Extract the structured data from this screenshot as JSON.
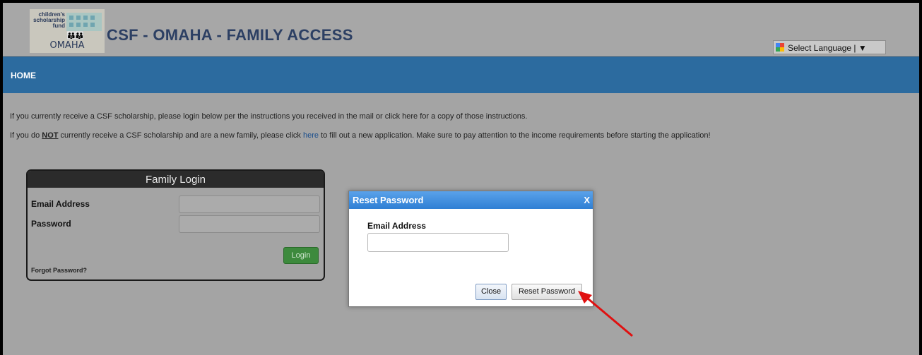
{
  "header": {
    "logo": {
      "line1": "children's",
      "line2": "scholarship",
      "line3": "fund",
      "city": "OMAHA"
    },
    "title": "CSF - OMAHA - FAMILY ACCESS",
    "language_select": {
      "label": "Select Language",
      "arrow": "▼"
    }
  },
  "nav": {
    "home": "HOME"
  },
  "content": {
    "line1": "If you currently receive a CSF scholarship, please login below per the instructions you received in the mail or click here for a copy of those instructions.",
    "line2_a": "If you do ",
    "line2_not": "NOT",
    "line2_b": " currently receive a CSF scholarship and are a new family, please click ",
    "line2_link": "here",
    "line2_c": " to fill out a new application. Make sure to pay attention to the income requirements before starting the application!"
  },
  "login_panel": {
    "title": "Family Login",
    "email_label": "Email Address",
    "email_value": "",
    "password_label": "Password",
    "password_value": "",
    "login_button": "Login",
    "forgot_link": "Forgot Password?"
  },
  "reset_dialog": {
    "title": "Reset Password",
    "close_x": "X",
    "email_label": "Email Address",
    "email_value": "",
    "close_button": "Close",
    "reset_button": "Reset Password"
  },
  "colors": {
    "nav_bar": "#2c6b9f",
    "dialog_title": "#2f7fd4",
    "login_button": "#3d8a3d",
    "arrow": "#e01010"
  }
}
